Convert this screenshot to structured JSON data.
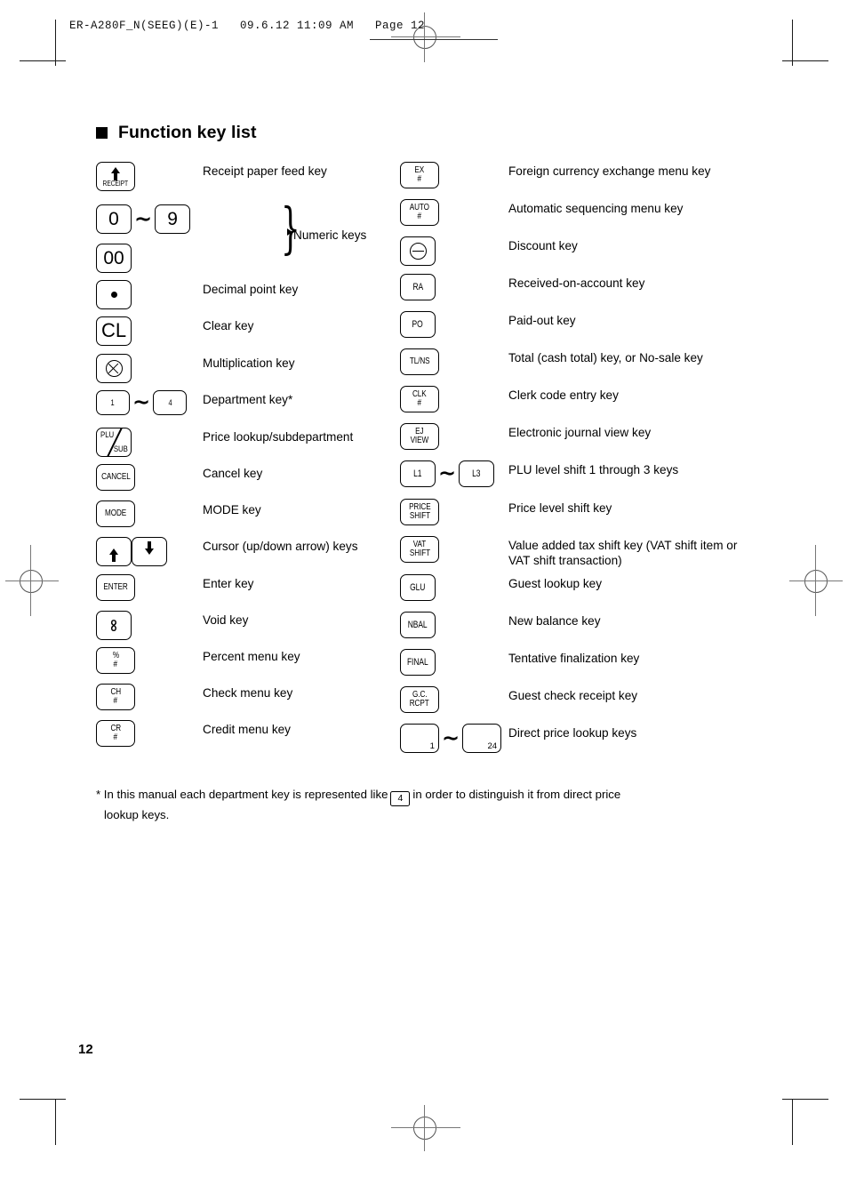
{
  "print_slug": "ER-A280F_N(SEEG)(E)-1   09.6.12 11:09 AM   Page 12",
  "heading": "Function key list",
  "page_number": "12",
  "left_column": [
    {
      "name": "receipt-feed",
      "keys": [
        {
          "type": "receipt",
          "text": "RECEIPT"
        }
      ],
      "label": "Receipt paper feed key"
    },
    {
      "name": "numeric",
      "keys": [
        {
          "type": "num",
          "text": "0"
        },
        {
          "type": "tilde",
          "text": "∼"
        },
        {
          "type": "num",
          "text": "9"
        }
      ],
      "label": "Numeric keys",
      "grouped": true
    },
    {
      "name": "double-zero",
      "keys": [
        {
          "type": "num",
          "text": "00"
        }
      ],
      "label": ""
    },
    {
      "name": "decimal-point",
      "keys": [
        {
          "type": "dot",
          "text": "•"
        }
      ],
      "label": "Decimal point key"
    },
    {
      "name": "clear",
      "keys": [
        {
          "type": "big",
          "text": "CL"
        }
      ],
      "label": "Clear key"
    },
    {
      "name": "multiplication",
      "keys": [
        {
          "type": "circle-x",
          "text": "⊗"
        }
      ],
      "label": "Multiplication key"
    },
    {
      "name": "department",
      "keys": [
        {
          "type": "sm",
          "text": "1"
        },
        {
          "type": "tilde",
          "text": "∼"
        },
        {
          "type": "sm",
          "text": "4"
        }
      ],
      "label": "Department key*"
    },
    {
      "name": "price-lookup-subdepartment",
      "keys": [
        {
          "type": "plusub",
          "line1": "PLU",
          "line2": "SUB"
        }
      ],
      "label": "Price lookup/subdepartment"
    },
    {
      "name": "cancel",
      "keys": [
        {
          "type": "cond",
          "text": "CANCEL"
        }
      ],
      "label": "Cancel key"
    },
    {
      "name": "mode",
      "keys": [
        {
          "type": "cond",
          "text": "MODE"
        }
      ],
      "label": "MODE key"
    },
    {
      "name": "cursor",
      "keys": [
        {
          "type": "arrow-up",
          "text": "↑"
        },
        {
          "type": "arrow-down",
          "text": "↓"
        }
      ],
      "label": "Cursor (up/down arrow) keys"
    },
    {
      "name": "enter",
      "keys": [
        {
          "type": "cond",
          "text": "ENTER"
        }
      ],
      "label": "Enter key"
    },
    {
      "name": "void",
      "keys": [
        {
          "type": "void",
          "text": "∞"
        }
      ],
      "label": "Void key"
    },
    {
      "name": "percent-menu",
      "keys": [
        {
          "type": "two-line",
          "line1": "%",
          "line2": "#"
        }
      ],
      "label": "Percent menu key"
    },
    {
      "name": "check-menu",
      "keys": [
        {
          "type": "two-line",
          "line1": "CH",
          "line2": "#"
        }
      ],
      "label": "Check menu key"
    },
    {
      "name": "credit-menu",
      "keys": [
        {
          "type": "two-line",
          "line1": "CR",
          "line2": "#"
        }
      ],
      "label": "Credit menu key"
    }
  ],
  "right_column": [
    {
      "name": "foreign-currency-exchange",
      "keys": [
        {
          "type": "two-line",
          "line1": "EX",
          "line2": "#"
        }
      ],
      "label": "Foreign currency exchange menu key"
    },
    {
      "name": "automatic-sequencing",
      "keys": [
        {
          "type": "two-line",
          "line1": "AUTO",
          "line2": "#"
        }
      ],
      "label": "Automatic sequencing menu key"
    },
    {
      "name": "discount",
      "keys": [
        {
          "type": "circle-minus",
          "text": "⊖"
        }
      ],
      "label": "Discount key"
    },
    {
      "name": "received-on-account",
      "keys": [
        {
          "type": "md",
          "text": "RA"
        }
      ],
      "label": "Received-on-account key"
    },
    {
      "name": "paid-out",
      "keys": [
        {
          "type": "md",
          "text": "PO"
        }
      ],
      "label": "Paid-out key"
    },
    {
      "name": "total-no-sale",
      "keys": [
        {
          "type": "wide",
          "text": "TL/NS"
        }
      ],
      "label": "Total (cash total) key, or No-sale key"
    },
    {
      "name": "clerk-code-entry",
      "keys": [
        {
          "type": "two-line",
          "line1": "CLK",
          "line2": "#"
        }
      ],
      "label": "Clerk code entry key"
    },
    {
      "name": "electronic-journal-view",
      "keys": [
        {
          "type": "two-line",
          "line1": "EJ",
          "line2": "VIEW"
        }
      ],
      "label": "Electronic journal view key"
    },
    {
      "name": "plu-level-shift",
      "keys": [
        {
          "type": "md",
          "text": "L1"
        },
        {
          "type": "tilde",
          "text": "∼"
        },
        {
          "type": "md",
          "text": "L3"
        }
      ],
      "label": "PLU level shift 1 through 3 keys"
    },
    {
      "name": "price-level-shift",
      "keys": [
        {
          "type": "two-line",
          "line1": "PRICE",
          "line2": "SHIFT"
        }
      ],
      "label": "Price level shift key"
    },
    {
      "name": "vat-shift",
      "keys": [
        {
          "type": "two-line",
          "line1": "VAT",
          "line2": "SHIFT"
        }
      ],
      "label": "Value added tax shift key (VAT shift item or VAT shift transaction)"
    },
    {
      "name": "guest-lookup",
      "keys": [
        {
          "type": "md",
          "text": "GLU"
        }
      ],
      "label": "Guest lookup key"
    },
    {
      "name": "new-balance",
      "keys": [
        {
          "type": "md",
          "text": "NBAL"
        }
      ],
      "label": "New balance key"
    },
    {
      "name": "tentative-finalization",
      "keys": [
        {
          "type": "md",
          "text": "FINAL"
        }
      ],
      "label": "Tentative finalization key"
    },
    {
      "name": "guest-check-receipt",
      "keys": [
        {
          "type": "two-line",
          "line1": "G.C.",
          "line2": "RCPT"
        }
      ],
      "label": "Guest check receipt key"
    },
    {
      "name": "direct-price-lookup",
      "keys": [
        {
          "type": "dplu",
          "text": "1"
        },
        {
          "type": "tilde",
          "text": "∼"
        },
        {
          "type": "dplu",
          "text": "24"
        }
      ],
      "label": "Direct price lookup keys"
    }
  ],
  "footnote": {
    "lead": "* In this manual each department key is represented like",
    "inline_key": "4",
    "tail": "in order to distinguish it from direct price",
    "second_line": "lookup keys."
  }
}
